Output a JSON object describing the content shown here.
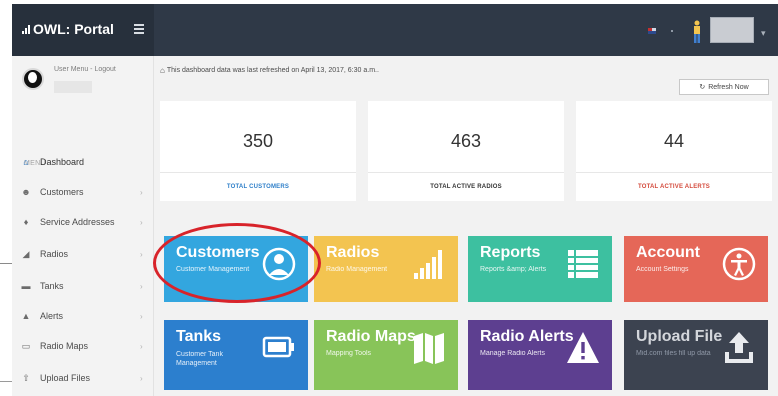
{
  "app": {
    "title": "OWL: Portal"
  },
  "user": {
    "menu_text": "User Menu - Logout"
  },
  "sidebar": {
    "heading": "MENU",
    "items": [
      {
        "label": "Dashboard",
        "icon": "home-icon",
        "active": true
      },
      {
        "label": "Customers",
        "icon": "user-icon"
      },
      {
        "label": "Service Addresses",
        "icon": "map-marker-icon"
      },
      {
        "label": "Radios",
        "icon": "signal-icon"
      },
      {
        "label": "Tanks",
        "icon": "tank-icon"
      },
      {
        "label": "Alerts",
        "icon": "warning-icon"
      },
      {
        "label": "Radio Maps",
        "icon": "map-icon"
      },
      {
        "label": "Upload Files",
        "icon": "upload-icon"
      }
    ]
  },
  "dashboard": {
    "refresh_note": "This dashboard data was last refreshed on April 13, 2017, 6:30 a.m..",
    "refresh_button": "Refresh Now"
  },
  "stats": [
    {
      "value": "350",
      "label": "TOTAL CUSTOMERS",
      "color": "#2e7fc9"
    },
    {
      "value": "463",
      "label": "TOTAL ACTIVE RADIOS",
      "color": "#333333"
    },
    {
      "value": "44",
      "label": "TOTAL ACTIVE ALERTS",
      "color": "#d44b3d"
    }
  ],
  "tiles": [
    {
      "title": "Customers",
      "subtitle": "Customer Management",
      "color": "#33a6df",
      "icon": "user-circle-icon"
    },
    {
      "title": "Radios",
      "subtitle": "Radio Management",
      "color": "#f3c450",
      "icon": "signal-bars-icon"
    },
    {
      "title": "Reports",
      "subtitle": "Reports &amp; Alerts",
      "color": "#3dc0a0",
      "icon": "list-icon"
    },
    {
      "title": "Account",
      "subtitle": "Account Settings",
      "color": "#e56758",
      "icon": "accessibility-icon"
    },
    {
      "title": "Tanks",
      "subtitle": "Customer Tank Management",
      "color": "#2c7fce",
      "icon": "battery-icon"
    },
    {
      "title": "Radio Maps",
      "subtitle": "Mapping Tools",
      "color": "#88c459",
      "icon": "map-icon"
    },
    {
      "title": "Radio Alerts",
      "subtitle": "Manage Radio Alerts",
      "color": "#5d3f90",
      "icon": "warning-icon"
    },
    {
      "title": "Upload File",
      "subtitle": "Mid.com files fill up data",
      "color": "#3c4350",
      "icon": "upload-icon"
    }
  ],
  "annotation": {
    "color": "#d8232a"
  }
}
